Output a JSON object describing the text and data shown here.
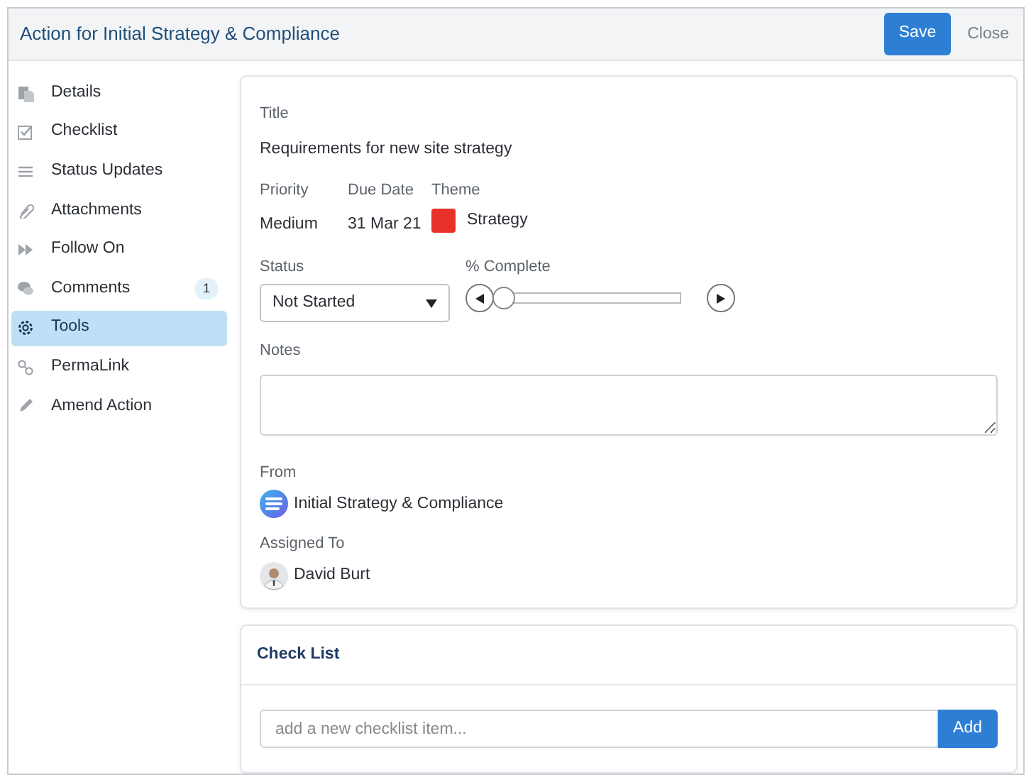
{
  "window": {
    "title": "Action for Initial Strategy & Compliance"
  },
  "header_buttons": [
    {
      "label": "Save",
      "kind": "primary"
    },
    {
      "label": "Close",
      "kind": "link"
    }
  ],
  "sidebar": {
    "items": [
      {
        "label": "Details",
        "selected": false
      },
      {
        "label": "Checklist",
        "selected": false
      },
      {
        "label": "Status Updates",
        "selected": false
      },
      {
        "label": "Attachments",
        "selected": false
      },
      {
        "label": "Follow On",
        "selected": false
      },
      {
        "label": "Comments",
        "selected": false,
        "badge": "1"
      },
      {
        "label": "Tools",
        "selected": true
      },
      {
        "label": "PermaLink",
        "selected": false
      },
      {
        "label": "Amend Action",
        "selected": false
      }
    ]
  },
  "details": {
    "title_label": "Title",
    "title": "Requirements for new site strategy",
    "priority_label": "Priority",
    "priority": "Medium",
    "due_date_label": "Due Date",
    "due_date": "31 Mar 21",
    "theme_label": "Theme",
    "theme": "Strategy",
    "status_label": "Status",
    "status": "Not Started",
    "complete_label": "% Complete",
    "complete": {
      "level": 0
    },
    "notes_label": "Notes",
    "from_label": "From",
    "from": "Initial Strategy & Compliance",
    "assigned_label": "Assigned To",
    "assigned": "David Burt"
  },
  "checklist": {
    "title": "Check List",
    "placeholder": "add a new checklist item...",
    "button": "Add"
  }
}
